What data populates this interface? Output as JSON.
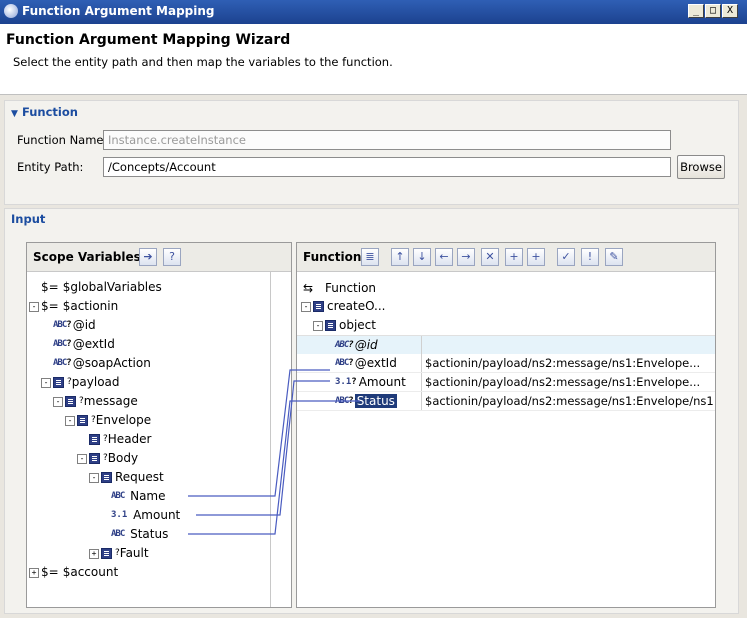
{
  "window": {
    "title": "Function Argument Mapping",
    "buttons": {
      "minimize": "_",
      "maximize": "□",
      "close": "X"
    }
  },
  "wizard": {
    "title": "Function Argument Mapping Wizard",
    "description": "Select the entity path and then map the variables to the function."
  },
  "function_section": {
    "header": "Function",
    "function_name_label": "Function Name:",
    "function_name_value": "Instance.createInstance",
    "entity_path_label": "Entity Path:",
    "entity_path_value": "/Concepts/Account",
    "browse_label": "Browse"
  },
  "input_section": {
    "header": "Input"
  },
  "scope_panel": {
    "title": "Scope Variables",
    "toolbar_icons": [
      "insert-icon",
      "help-icon"
    ],
    "tree": [
      {
        "label": "$globalVariables",
        "icon": "dollar-icon"
      },
      {
        "label": "$actionin",
        "icon": "dollar-icon",
        "expander": "-"
      },
      {
        "label": "@id",
        "icon": "string-icon"
      },
      {
        "label": "@extId",
        "icon": "string-icon"
      },
      {
        "label": "@soapAction",
        "icon": "string-icon"
      },
      {
        "label": "payload",
        "icon": "complex-icon",
        "expander": "-"
      },
      {
        "label": "message",
        "icon": "complex-icon",
        "expander": "-"
      },
      {
        "label": "Envelope",
        "icon": "complex-icon",
        "expander": "-"
      },
      {
        "label": "Header",
        "icon": "complex-icon"
      },
      {
        "label": "Body",
        "icon": "complex-icon",
        "expander": "-"
      },
      {
        "label": "Request",
        "icon": "complex-icon",
        "expander": "-"
      },
      {
        "label": "Name",
        "icon": "string-icon"
      },
      {
        "label": "Amount",
        "icon": "number-icon"
      },
      {
        "label": "Status",
        "icon": "string-icon"
      },
      {
        "label": "Fault",
        "icon": "complex-icon",
        "expander": "+"
      },
      {
        "label": "$account",
        "icon": "dollar-icon",
        "expander": "+"
      }
    ]
  },
  "function_panel": {
    "title": "Function",
    "toolbar_icons": [
      "list-icon",
      "move-up-icon",
      "move-down-icon",
      "move-left-icon",
      "move-right-icon",
      "delete-icon",
      "add-icon",
      "add-child-icon",
      "check-icon",
      "warning-icon",
      "edit-icon"
    ],
    "tree": [
      {
        "label": "Function",
        "icon": "function-icon"
      },
      {
        "label": "createO...",
        "icon": "complex-icon",
        "expander": "-"
      },
      {
        "label": "object",
        "icon": "complex-icon",
        "expander": "-"
      },
      {
        "label": "@id",
        "icon": "string-icon",
        "value": ""
      },
      {
        "label": "@extId",
        "icon": "string-icon",
        "value": "$actionin/payload/ns2:message/ns1:Envelope..."
      },
      {
        "label": "Amount",
        "icon": "number-icon",
        "value": "$actionin/payload/ns2:message/ns1:Envelope..."
      },
      {
        "label": "Status",
        "icon": "string-icon",
        "value": "$actionin/payload/ns2:message/ns1:Envelope/ns1"
      }
    ]
  },
  "colors": {
    "accent": "#1c4da0",
    "selection": "#1f3b7a",
    "mapping_line": "#4a5cc0"
  }
}
